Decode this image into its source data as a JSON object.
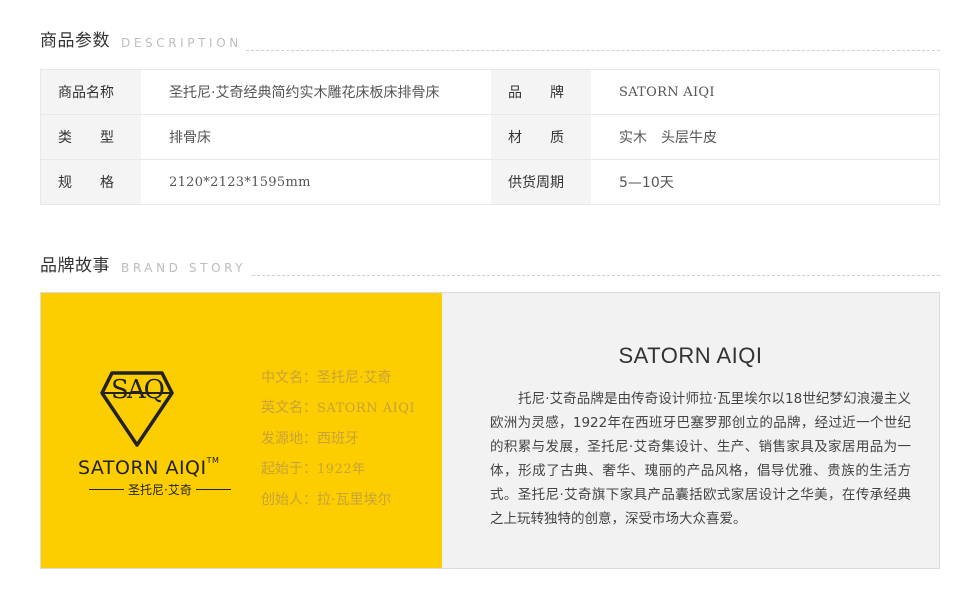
{
  "description_section": {
    "title": "商品参数",
    "subtitle": "DESCRIPTION"
  },
  "specs": {
    "rows": [
      {
        "label_left": "商品名称",
        "value_left": "圣托尼·艾奇经典简约实木雕花床板床排骨床",
        "label_right": "品　　牌",
        "value_right": "SATORN AIQI"
      },
      {
        "label_left": "类　　型",
        "value_left": "排骨床",
        "label_right": "材　　质",
        "value_right": "实木　头层牛皮"
      },
      {
        "label_left": "规　　格",
        "value_left": "2120*2123*1595mm",
        "label_right": "供货周期",
        "value_right": "5—10天"
      }
    ]
  },
  "brand_section": {
    "title": "品牌故事",
    "subtitle": "BRAND STORY"
  },
  "brand": {
    "logo_monogram": "SAQ",
    "logo_name": "SATORN AIQI",
    "logo_tm": "TM",
    "logo_cn": "圣托尼·艾奇",
    "facts": [
      {
        "label": "中文名：",
        "value": "圣托尼·艾奇"
      },
      {
        "label": "英文名：",
        "value": "SATORN AIQI"
      },
      {
        "label": "发源地：",
        "value": "西班牙"
      },
      {
        "label": "起始于：",
        "value": "1922年"
      },
      {
        "label": "创始人：",
        "value": "拉·瓦里埃尔"
      }
    ],
    "name": "SATORN AIQI",
    "story": "托尼·艾奇品牌是由传奇设计师拉·瓦里埃尔以18世纪梦幻浪漫主义欧洲为灵感，1922年在西班牙巴塞罗那创立的品牌，经过近一个世纪的积累与发展，圣托尼·艾奇集设计、生产、销售家具及家居用品为一体，形成了古典、奢华、瑰丽的产品风格，倡导优雅、贵族的生活方式。圣托尼·艾奇旗下家具产品囊括欧式家居设计之华美，在传承经典之上玩转独特的创意，深受市场大众喜爱。",
    "colors": {
      "panel_yellow": "#fcce00",
      "fact_text": "#c8a23a"
    }
  }
}
